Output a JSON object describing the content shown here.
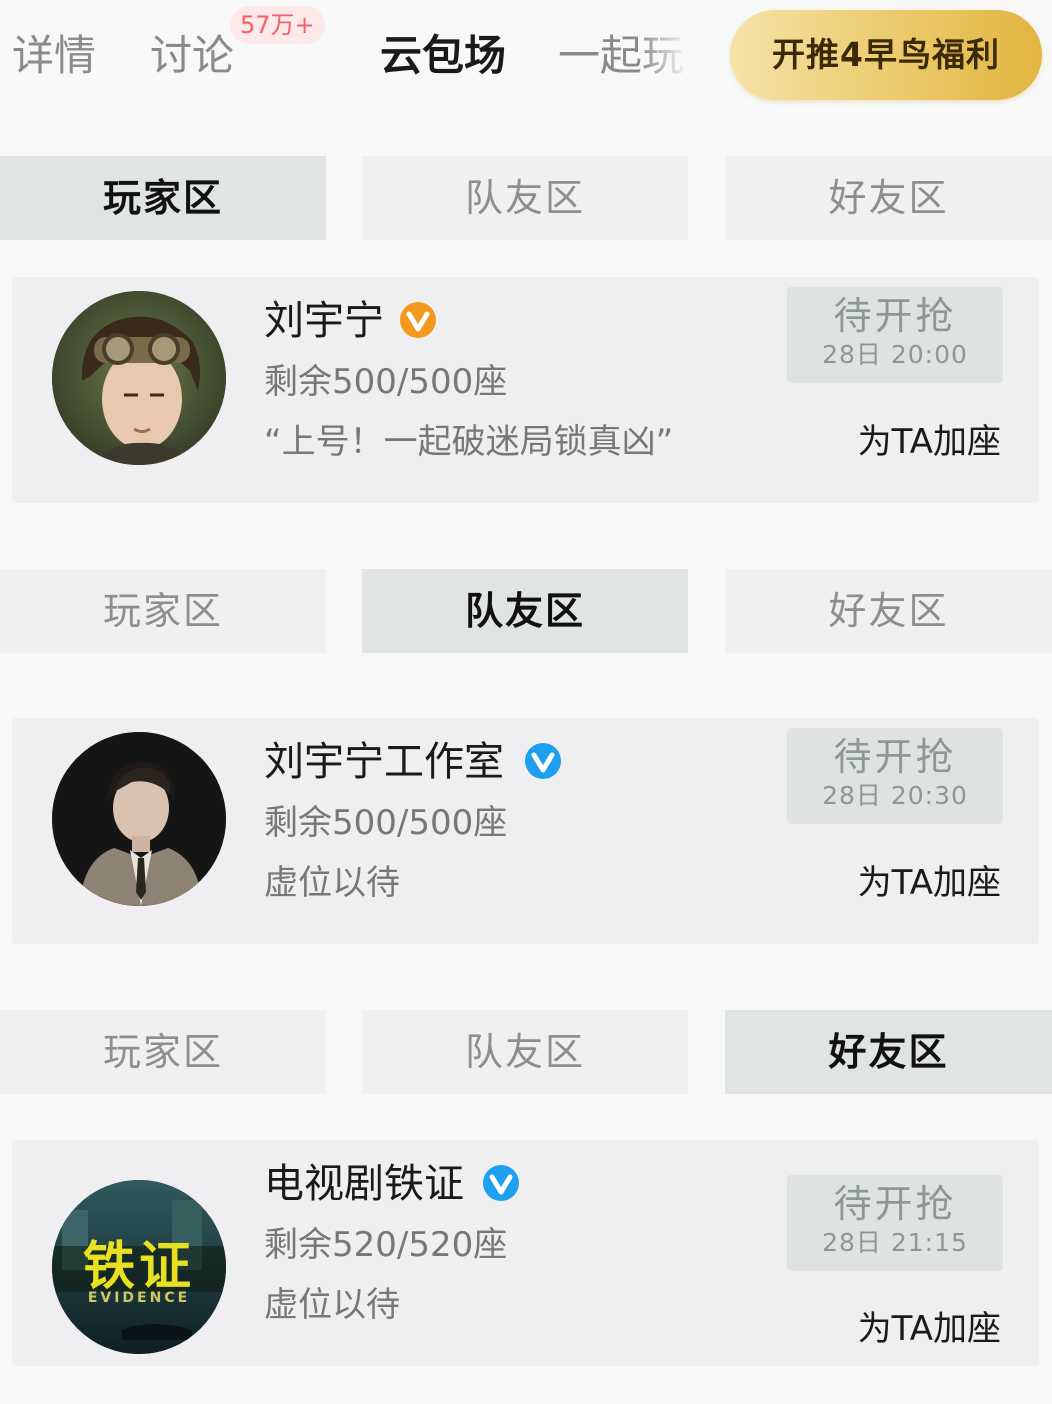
{
  "top_tabs": {
    "detail": "详情",
    "discuss": "讨论",
    "discuss_badge": "57万+",
    "cloud": "云包场",
    "play": "一起玩",
    "active": "云包场"
  },
  "promo_button": "开推4早鸟福利",
  "zone_labels": [
    "玩家区",
    "队友区",
    "好友区"
  ],
  "sections": [
    {
      "active_zone": 0,
      "card": {
        "name": "刘宇宁",
        "verify_color": "#f39a1e",
        "seats": "剩余500/500座",
        "note": "“上号！一起破迷局锁真凶”",
        "status": "待开抢",
        "time": "28日 20:00",
        "add_seat": "为TA加座"
      }
    },
    {
      "active_zone": 1,
      "card": {
        "name": "刘宇宁工作室",
        "verify_color": "#1f9ff0",
        "seats": "剩余500/500座",
        "note": "虚位以待",
        "status": "待开抢",
        "time": "28日 20:30",
        "add_seat": "为TA加座"
      }
    },
    {
      "active_zone": 2,
      "card": {
        "name": "电视剧铁证",
        "verify_color": "#1f9ff0",
        "seats": "剩余520/520座",
        "note": "虚位以待",
        "status": "待开抢",
        "time": "28日 21:15",
        "add_seat": "为TA加座",
        "avatar_logo_text": "铁证",
        "avatar_logo_subtext": "EVIDENCE"
      }
    }
  ],
  "colors": {
    "active_zone_bg": "#e0e4e3",
    "zone_bg": "#f0f0f0",
    "card_bg": "#efeff1",
    "promo_gold": "#e2b540",
    "badge_text": "#f0606a"
  },
  "icons": [
    "verified-orange-icon",
    "verified-blue-icon"
  ]
}
